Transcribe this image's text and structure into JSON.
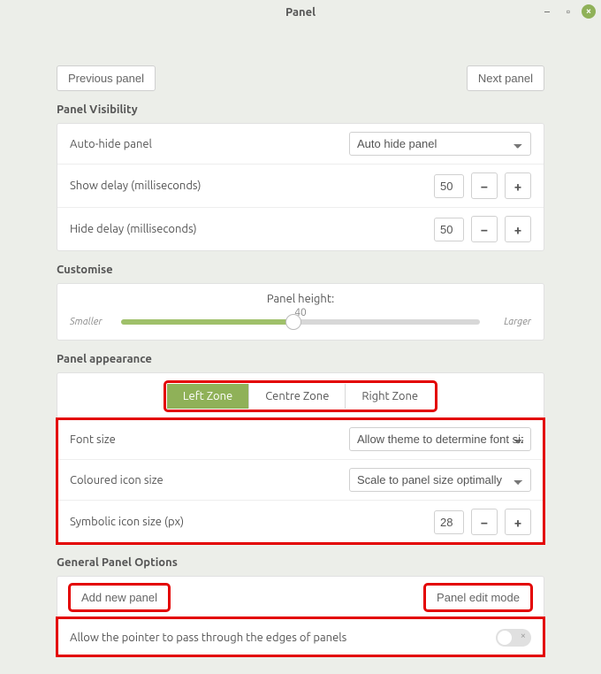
{
  "window": {
    "title": "Panel"
  },
  "nav": {
    "prev_label": "Previous panel",
    "next_label": "Next panel"
  },
  "visibility": {
    "section_title": "Panel Visibility",
    "autohide_label": "Auto-hide panel",
    "autohide_value": "Auto hide panel",
    "show_delay_label": "Show delay (milliseconds)",
    "show_delay_value": "50",
    "hide_delay_label": "Hide delay (milliseconds)",
    "hide_delay_value": "50"
  },
  "customise": {
    "section_title": "Customise",
    "height_label": "Panel height:",
    "height_value": "40",
    "smaller_label": "Smaller",
    "larger_label": "Larger",
    "slider_percent": 48
  },
  "appearance": {
    "section_title": "Panel appearance",
    "tabs": {
      "left": "Left Zone",
      "centre": "Centre Zone",
      "right": "Right Zone"
    },
    "font_size_label": "Font size",
    "font_size_value": "Allow theme to determine font size",
    "coloured_icon_label": "Coloured icon size",
    "coloured_icon_value": "Scale to panel size optimally",
    "symbolic_icon_label": "Symbolic icon size (px)",
    "symbolic_icon_value": "28"
  },
  "general": {
    "section_title": "General Panel Options",
    "add_panel_label": "Add new panel",
    "edit_mode_label": "Panel edit mode",
    "pass_through_label": "Allow the pointer to pass through the edges of panels",
    "pass_through_on": false
  },
  "glyphs": {
    "minus": "−",
    "plus": "+",
    "min": "–",
    "max": "▫",
    "close": "×"
  }
}
